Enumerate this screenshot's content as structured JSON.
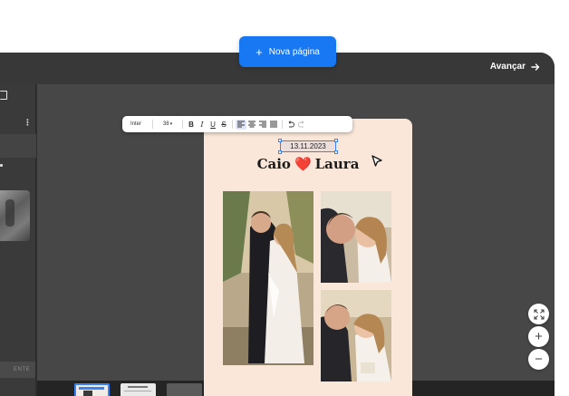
{
  "header": {
    "add_page_label": "Nova página",
    "next_label": "Avançar"
  },
  "sidebar": {
    "bottom_button_label": "ENTE"
  },
  "toolbar": {
    "font": "Inter",
    "font_size": "38",
    "bold": "B",
    "italic": "I",
    "underline": "U",
    "strike": "S"
  },
  "page": {
    "date": "13.11.2023",
    "name_left": "Caio",
    "heart": "❤️",
    "name_right": "Laura",
    "background": "#fae7da"
  },
  "zoom": {
    "zoom_in_label": "+",
    "zoom_out_label": "−"
  },
  "colors": {
    "accent": "#1877f2",
    "selection": "#3b82f6"
  }
}
